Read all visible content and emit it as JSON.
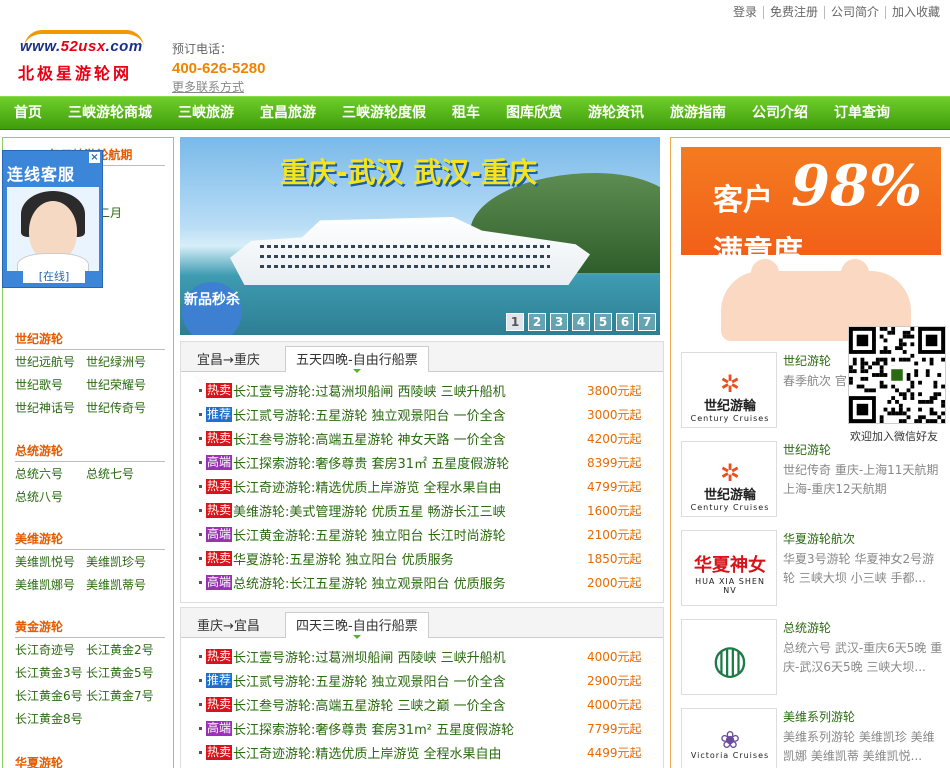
{
  "toplinks": [
    "登录",
    "免费注册",
    "公司简介",
    "加入收藏"
  ],
  "logo": {
    "en_prefix": "www.",
    "en_red": "52usx",
    "en_suffix": ".com",
    "cn": "北极星游轮网"
  },
  "phone": {
    "label": "预订电话：",
    "number": "400-626-5280",
    "more": "更多联系方式"
  },
  "nav": [
    "首页",
    "三峡游轮商城",
    "三峡旅游",
    "宜昌旅游",
    "三峡游轮度假",
    "租车",
    "图库欣赏",
    "游轮资讯",
    "旅游指南",
    "公司介绍",
    "订单查询"
  ],
  "kefu": {
    "title": "连线客服",
    "status": "[在线]",
    "close": "×"
  },
  "left": {
    "schedule": {
      "title": "2025年三峡游轮航期",
      "months": [
        "",
        "",
        "",
        "",
        "",
        "",
        "",
        "",
        "",
        "",
        "十一月",
        "十二月"
      ]
    },
    "sections": [
      {
        "title": "世纪游轮",
        "items": [
          "世纪远航号",
          "世纪绿洲号",
          "世纪歌号",
          "世纪荣耀号",
          "世纪神话号",
          "世纪传奇号"
        ]
      },
      {
        "title": "总统游轮",
        "items": [
          "总统六号",
          "总统七号",
          "总统八号"
        ]
      },
      {
        "title": "美维游轮",
        "items": [
          "美维凯悦号",
          "美维凯珍号",
          "美维凯娜号",
          "美维凯蒂号"
        ]
      },
      {
        "title": "黄金游轮",
        "items": [
          "长江奇迹号",
          "长江黄金2号",
          "长江黄金3号",
          "长江黄金5号",
          "长江黄金6号",
          "长江黄金7号",
          "长江黄金8号"
        ]
      },
      {
        "title": "华夏游轮",
        "items": []
      }
    ]
  },
  "banner": {
    "title": "重庆-武汉  武汉-重庆",
    "badge": "新品秒杀",
    "ship_name": "",
    "pages": [
      "1",
      "2",
      "3",
      "4",
      "5",
      "6",
      "7"
    ]
  },
  "box1": {
    "tab_a": "宜昌→重庆",
    "tab_b": "五天四晚-自由行船票",
    "rows": [
      {
        "tag": "热卖",
        "type": "hot",
        "text": "长江壹号游轮:过葛洲坝船闸 西陵峡 三峡升船机",
        "price": "3800元起"
      },
      {
        "tag": "推荐",
        "type": "rec",
        "text": "长江贰号游轮:五星游轮 独立观景阳台 一价全含",
        "price": "3000元起"
      },
      {
        "tag": "热卖",
        "type": "hot",
        "text": "长江叁号游轮:高端五星游轮 神女天路 一价全含",
        "price": "4200元起"
      },
      {
        "tag": "高端",
        "type": "full",
        "text": "长江探索游轮:奢侈尊贵 套房31㎡ 五星度假游轮",
        "price": "8399元起"
      },
      {
        "tag": "热卖",
        "type": "hot",
        "text": "长江奇迹游轮:精选优质上岸游览 全程水果自由",
        "price": "4799元起"
      },
      {
        "tag": "热卖",
        "type": "hot",
        "text": "美维游轮:美式管理游轮 优质五星  畅游长江三峡",
        "price": "1600元起"
      },
      {
        "tag": "高端",
        "type": "full",
        "text": "长江黄金游轮:五星游轮 独立阳台 长江时尚游轮",
        "price": "2100元起"
      },
      {
        "tag": "热卖",
        "type": "hot",
        "text": "华夏游轮:五星游轮  独立阳台 优质服务",
        "price": "1850元起"
      },
      {
        "tag": "高端",
        "type": "full",
        "text": "总统游轮:长江五星游轮 独立观景阳台 优质服务",
        "price": "2000元起"
      }
    ]
  },
  "box2": {
    "tab_a": "重庆→宜昌",
    "tab_b": "四天三晚-自由行船票",
    "rows": [
      {
        "tag": "热卖",
        "type": "hot",
        "text": "长江壹号游轮:过葛洲坝船闸 西陵峡 三峡升船机",
        "price": "4000元起"
      },
      {
        "tag": "推荐",
        "type": "rec",
        "text": "长江贰号游轮:五星游轮 独立观景阳台 一价全含",
        "price": "2900元起"
      },
      {
        "tag": "热卖",
        "type": "hot",
        "text": "长江叁号游轮:高端五星游轮  三峡之巅 一价全含",
        "price": "4000元起"
      },
      {
        "tag": "高端",
        "type": "full",
        "text": "长江探索游轮:奢侈尊贵 套房31m² 五星度假游轮",
        "price": "7799元起"
      },
      {
        "tag": "热卖",
        "type": "hot",
        "text": "长江奇迹游轮:精选优质上岸游览 全程水果自由",
        "price": "4499元起"
      }
    ]
  },
  "rbanner": {
    "line1": "客户",
    "pct": "98%",
    "line2": "满意度"
  },
  "right_items": [
    {
      "name": "世纪游轮",
      "desc": "春季航次 官\n春季航次",
      "logo_cn": "世纪游輪",
      "logo_en": "Century Cruises"
    },
    {
      "name": "世纪游轮",
      "desc": "世纪传奇 重庆-上海11天航期 上海-重庆12天航期",
      "logo_cn": "世纪游輪",
      "logo_en": "Century Cruises"
    },
    {
      "name": "华夏游轮航次",
      "desc": "华夏3号游轮 华夏神女2号游轮 三峡大坝 小三峡 手都...",
      "logo_cn": "华夏神女",
      "logo_en": "HUA XIA SHEN NV"
    },
    {
      "name": "总统游轮",
      "desc": "总统六号 武汉-重庆6天5晚 重庆-武汉6天5晚 三峡大坝...",
      "logo_cn": "",
      "logo_en": ""
    },
    {
      "name": "美维系列游轮",
      "desc": "美维系列游轮 美维凯珍 美维凯娜 美维凯蒂 美维凯悦...",
      "logo_cn": "",
      "logo_en": "Victoria Cruises"
    }
  ],
  "qr_label": "欢迎加入微信好友",
  "colors": {
    "nav_green": "#4fb31a",
    "orange": "#f08300",
    "link_green": "#2a6a10",
    "hot_red": "#d8141a"
  }
}
